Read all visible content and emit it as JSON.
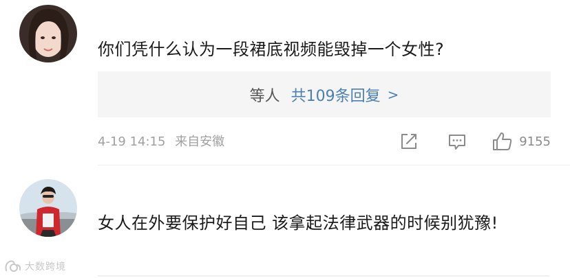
{
  "comments": [
    {
      "text": "你们凭什么认为一段裙底视频能毁掉一个女性?",
      "reply_preview": {
        "users_label": "等人",
        "count_label": "共109条回复",
        "arrow": ">"
      },
      "timestamp": "4-19 14:15",
      "source": "来自安徽",
      "like_count": "9155",
      "icons": [
        "share-icon",
        "comment-icon",
        "thumbs-up-icon"
      ]
    },
    {
      "text": "女人在外要保护好自己 该拿起法律武器的时候别犹豫!"
    }
  ],
  "watermark": {
    "text": "大数跨境"
  },
  "colors": {
    "link": "#4a7fb5",
    "meta": "#a0a0a0",
    "reply_bg": "#f5f5f5",
    "text": "#1a1a1a"
  }
}
